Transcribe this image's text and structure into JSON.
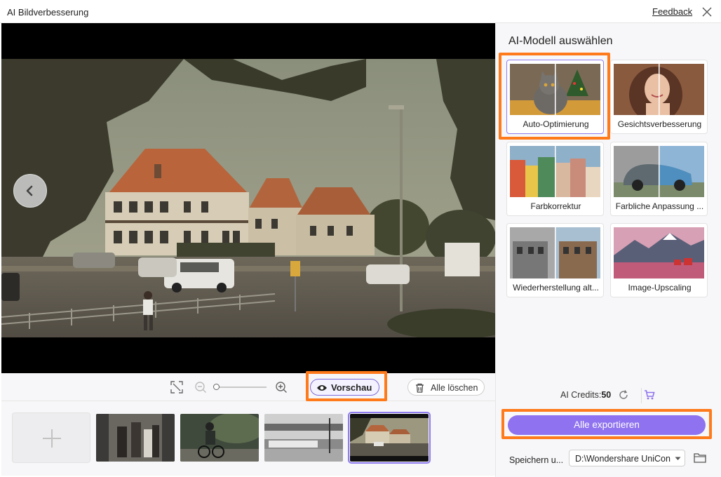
{
  "window": {
    "title": "AI Bildverbesserung",
    "feedback_label": "Feedback"
  },
  "toolbar": {
    "preview_label": "Vorschau",
    "clear_all_label": "Alle löschen"
  },
  "panel": {
    "title": "AI-Modell auswählen",
    "models": [
      {
        "label": "Auto-Optimierung"
      },
      {
        "label": "Gesichtsverbesserung"
      },
      {
        "label": "Farbkorrektur"
      },
      {
        "label": "Farbliche Anpassung ..."
      },
      {
        "label": "Wiederherstellung alt..."
      },
      {
        "label": "Image-Upscaling"
      }
    ],
    "credits_label": "AI Credits:",
    "credits_value": "50",
    "export_label": "Alle exportieren",
    "save_label": "Speichern u...",
    "save_path": "D:\\Wondershare UniCon"
  },
  "colors": {
    "accent": "#8f72ef",
    "highlight": "#ff7a1a",
    "selection": "#8e7cf0"
  },
  "icons": [
    "close-icon",
    "arrow-left-icon",
    "fit-screen-icon",
    "zoom-out-icon",
    "zoom-in-icon",
    "eye-icon",
    "trash-icon",
    "plus-icon",
    "refresh-icon",
    "cart-icon",
    "chevron-down-icon",
    "folder-icon"
  ]
}
